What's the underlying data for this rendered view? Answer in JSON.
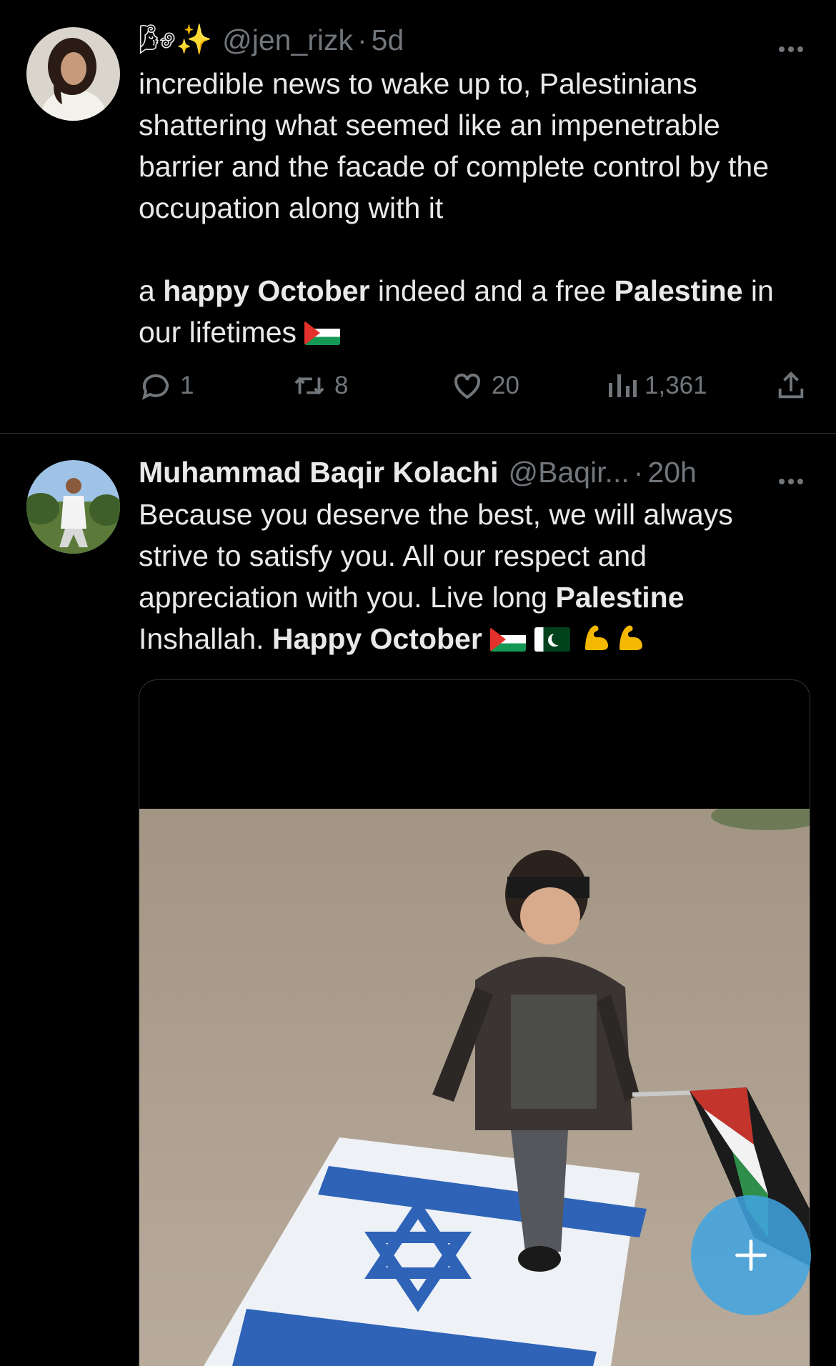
{
  "tweets": [
    {
      "display_name_emoji": "🌬✨",
      "handle": "@jen_rizk",
      "separator": "·",
      "time": "5d",
      "paragraph1": "incredible news to wake up to, Palestinians shattering what seemed like an impenetrable barrier and the facade of complete control by the occupation along with it",
      "paragraph2": {
        "t1": "a ",
        "b1": "happy October",
        "t2": " indeed and a free ",
        "b2": "Palestine",
        "t3": " in our lifetimes"
      },
      "actions": {
        "replies": "1",
        "retweets": "8",
        "likes": "20",
        "views": "1,361"
      },
      "avatar_icon": "avatar-woman"
    },
    {
      "display_name": "Muhammad Baqir Kolachi",
      "handle": "@Baqir...",
      "separator": "·",
      "time": "20h",
      "text": {
        "t1": "Because you deserve the best, we will always strive to satisfy you. All our respect and appreciation with you. Live long ",
        "b1": "Palestine",
        "t2": " Inshallah. ",
        "b2": "Happy October"
      },
      "avatar_icon": "avatar-man",
      "media_icon": "photo-child-flag"
    }
  ],
  "icons": {
    "reply": "reply-icon",
    "retweet": "retweet-icon",
    "like": "heart-icon",
    "views": "views-icon",
    "share": "share-icon",
    "more": "more-icon",
    "fab": "plus-icon"
  },
  "colors": {
    "background": "#000000",
    "text": "#e7e9ea",
    "muted": "#71767b",
    "divider": "#2f3336",
    "fab": "#40a4e2"
  }
}
